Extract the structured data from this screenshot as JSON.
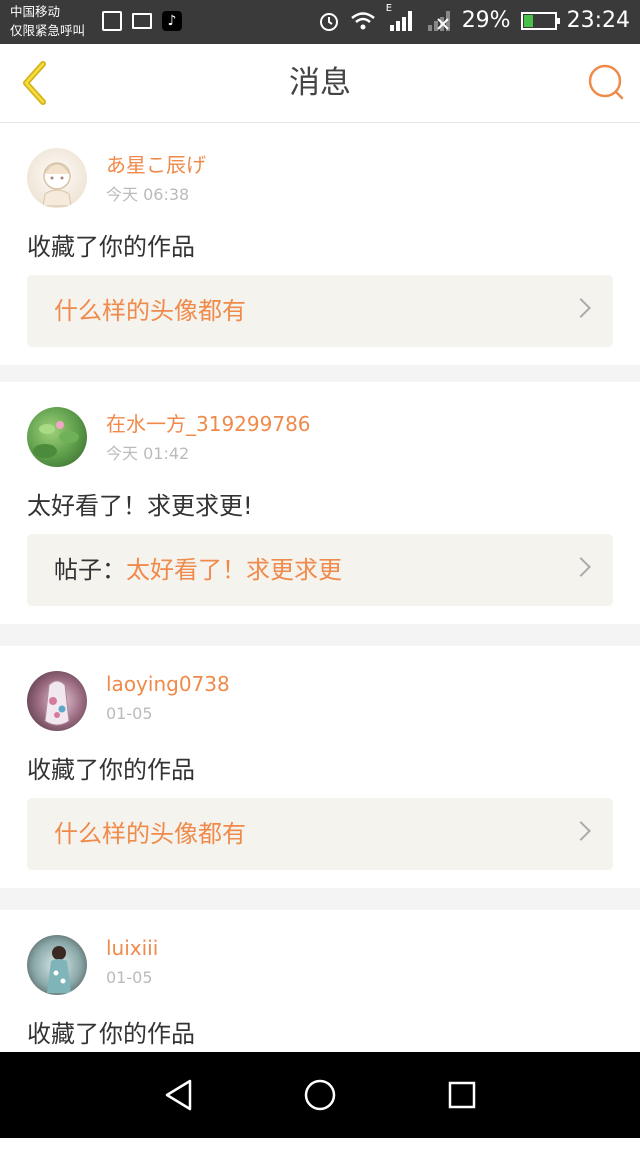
{
  "status_bar": {
    "carrier_line1": "中国移动",
    "carrier_line2": "仅限紧急呼叫",
    "network_type": "E",
    "battery_percent": "29%",
    "battery_level": 0.29,
    "time": "23:24",
    "colors": {
      "background": "#3a3a3a",
      "battery_fill": "#49c04a"
    }
  },
  "header": {
    "title": "消息",
    "back_icon": "chevron-left-icon",
    "search_icon": "search-icon",
    "accent_color": "#f08a4b"
  },
  "messages": [
    {
      "username": "あ星こ辰げ",
      "time": "今天 06:38",
      "text": "收藏了你的作品",
      "quote_prefix": "",
      "quote_text": "什么样的头像都有"
    },
    {
      "username": "在水一方_319299786",
      "time": "今天 01:42",
      "text": "太好看了！求更求更!",
      "quote_prefix": "帖子：",
      "quote_text": "太好看了！求更求更"
    },
    {
      "username": "laoying0738",
      "time": "01-05",
      "text": "收藏了你的作品",
      "quote_prefix": "",
      "quote_text": "什么样的头像都有"
    },
    {
      "username": "luixiii",
      "time": "01-05",
      "text": "收藏了你的作品",
      "quote_prefix": "",
      "quote_text": ""
    }
  ],
  "nav_bar": {
    "back_icon": "triangle-back-icon",
    "home_icon": "circle-home-icon",
    "recents_icon": "square-recents-icon"
  }
}
